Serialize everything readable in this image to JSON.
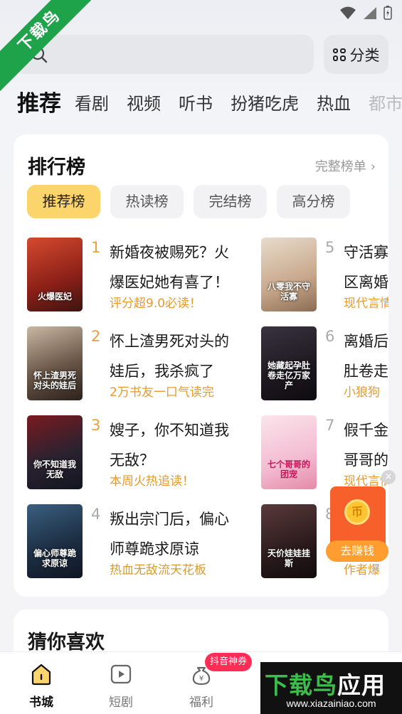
{
  "watermark": {
    "ribbon_text": "下载鸟",
    "brand_green": "下载鸟",
    "brand_white": "应用",
    "url": "www.xiazainiao.com"
  },
  "search": {
    "placeholder": "",
    "category_label": "分类"
  },
  "top_tabs": [
    "推荐",
    "看剧",
    "视频",
    "听书",
    "扮猪吃虎",
    "热血",
    "都市"
  ],
  "ranking": {
    "title": "排行榜",
    "full_list": "完整榜单",
    "tabs": [
      "推荐榜",
      "热读榜",
      "完结榜",
      "高分榜"
    ],
    "books": [
      {
        "rank": "1",
        "title": "新婚夜被赐死？火爆医妃她有喜了！",
        "tag": "评分超9.0必读！",
        "cover_text": "火爆医妃"
      },
      {
        "rank": "2",
        "title": "怀上渣男死对头的娃后，我杀疯了",
        "tag": "2万书友一口气读完",
        "cover_text": "怀上渣男死对头的娃后"
      },
      {
        "rank": "3",
        "title": "嫂子，你不知道我无敌？",
        "tag": "本周火热追读！",
        "cover_text": "你不知道我无敌"
      },
      {
        "rank": "4",
        "title": "叛出宗门后，偏心师尊跪求原谅",
        "tag": "热血无敌流天花板",
        "cover_text": "偏心师尊跪求原谅"
      },
      {
        "rank": "5",
        "title": "守活寡区离婚",
        "tag": "现代言情",
        "cover_text": "八零我不守活寡"
      },
      {
        "rank": "6",
        "title": "离婚后肚卷走",
        "tag": "小狼狗",
        "cover_text": "她藏起孕肚卷走亿万家产"
      },
      {
        "rank": "7",
        "title": "假千金哥哥的",
        "tag": "现代言情",
        "cover_text": "七个哥哥的团宠"
      },
      {
        "rank": "8",
        "title": "",
        "tag": "作者爆",
        "cover_text": "天价娃娃挂斯"
      }
    ]
  },
  "guess": {
    "title": "猜你喜欢"
  },
  "earn": {
    "coin": "币",
    "label": "去赚钱",
    "close": "×"
  },
  "bottom_nav": {
    "items": [
      "书城",
      "短剧",
      "福利"
    ],
    "promo_badge": "抖音神券"
  },
  "colors": {
    "accent": "#fbd46b",
    "rank_top": "#e6a23c",
    "tag": "#e69a2c",
    "earn": "#f8602b"
  }
}
